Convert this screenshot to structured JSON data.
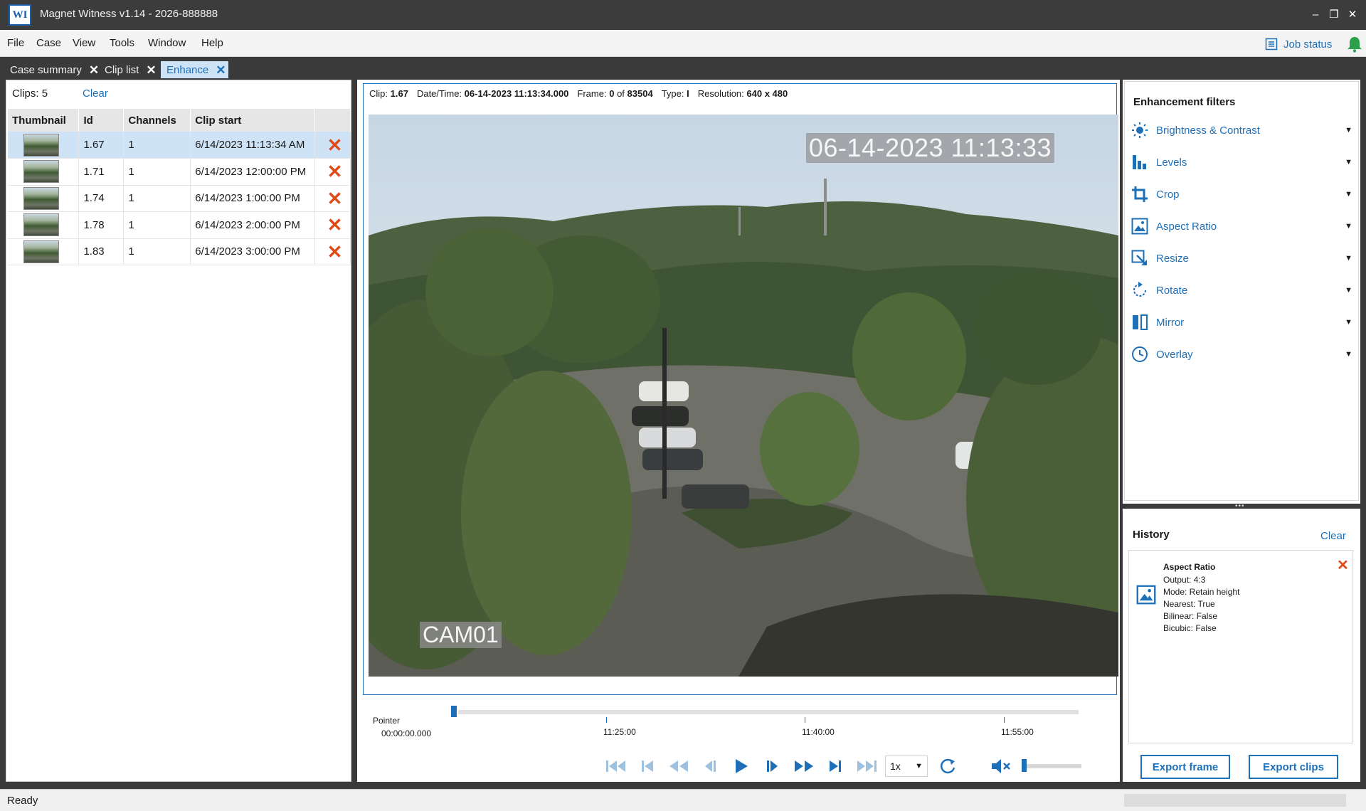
{
  "window": {
    "title": "Magnet Witness v1.14 - 2026-888888",
    "logo": "WI"
  },
  "menu": [
    "File",
    "Case",
    "View",
    "Tools",
    "Window",
    "Help"
  ],
  "job_status": "Job status",
  "tabs": [
    {
      "label": "Case summary",
      "active": false
    },
    {
      "label": "Clip list",
      "active": false
    },
    {
      "label": "Enhance",
      "active": true
    }
  ],
  "clips": {
    "count_label": "Clips:",
    "count": "5",
    "clear": "Clear",
    "columns": [
      "Thumbnail",
      "Id",
      "Channels",
      "Clip start"
    ],
    "rows": [
      {
        "id": "1.67",
        "channels": "1",
        "start": "6/14/2023 11:13:34 AM",
        "selected": true
      },
      {
        "id": "1.71",
        "channels": "1",
        "start": "6/14/2023 12:00:00 PM",
        "selected": false
      },
      {
        "id": "1.74",
        "channels": "1",
        "start": "6/14/2023 1:00:00 PM",
        "selected": false
      },
      {
        "id": "1.78",
        "channels": "1",
        "start": "6/14/2023 2:00:00 PM",
        "selected": false
      },
      {
        "id": "1.83",
        "channels": "1",
        "start": "6/14/2023 3:00:00 PM",
        "selected": false
      }
    ]
  },
  "info": {
    "clip_label": "Clip:",
    "clip": "1.67",
    "datetime_label": "Date/Time:",
    "datetime": "06-14-2023 11:13:34.000",
    "frame_label": "Frame:",
    "frame": "0",
    "of_label": "of",
    "frame_total": "83504",
    "type_label": "Type:",
    "type": "I",
    "res_label": "Resolution:",
    "res": "640 x 480"
  },
  "video": {
    "timestamp": "06-14-2023 11:13:33",
    "camera": "CAM01"
  },
  "timeline": {
    "pointer_label": "Pointer",
    "pointer_time": "00:00:00.000",
    "ticks": [
      "11:25:00",
      "11:40:00",
      "11:55:00"
    ]
  },
  "transport": {
    "speed": "1x"
  },
  "filters": {
    "title": "Enhancement filters",
    "items": [
      {
        "label": "Brightness & Contrast",
        "icon": "sun-icon"
      },
      {
        "label": "Levels",
        "icon": "levels-icon"
      },
      {
        "label": "Crop",
        "icon": "crop-icon"
      },
      {
        "label": "Aspect Ratio",
        "icon": "aspect-ratio-icon"
      },
      {
        "label": "Resize",
        "icon": "resize-icon"
      },
      {
        "label": "Rotate",
        "icon": "rotate-icon"
      },
      {
        "label": "Mirror",
        "icon": "mirror-icon"
      },
      {
        "label": "Overlay",
        "icon": "overlay-icon"
      }
    ]
  },
  "history": {
    "title": "History",
    "clear": "Clear",
    "entry": {
      "title": "Aspect Ratio",
      "lines": [
        "Output:  4:3",
        "Mode:  Retain height",
        "Nearest:  True",
        "Bilinear:  False",
        "Bicubic:  False"
      ]
    }
  },
  "export": {
    "frame": "Export frame",
    "clips": "Export clips"
  },
  "status": {
    "text": "Ready"
  },
  "colors": {
    "accent": "#1d6fb8",
    "delete": "#e04a16",
    "chrome": "#3a3a3a",
    "selected_row": "#cfe3f6"
  }
}
